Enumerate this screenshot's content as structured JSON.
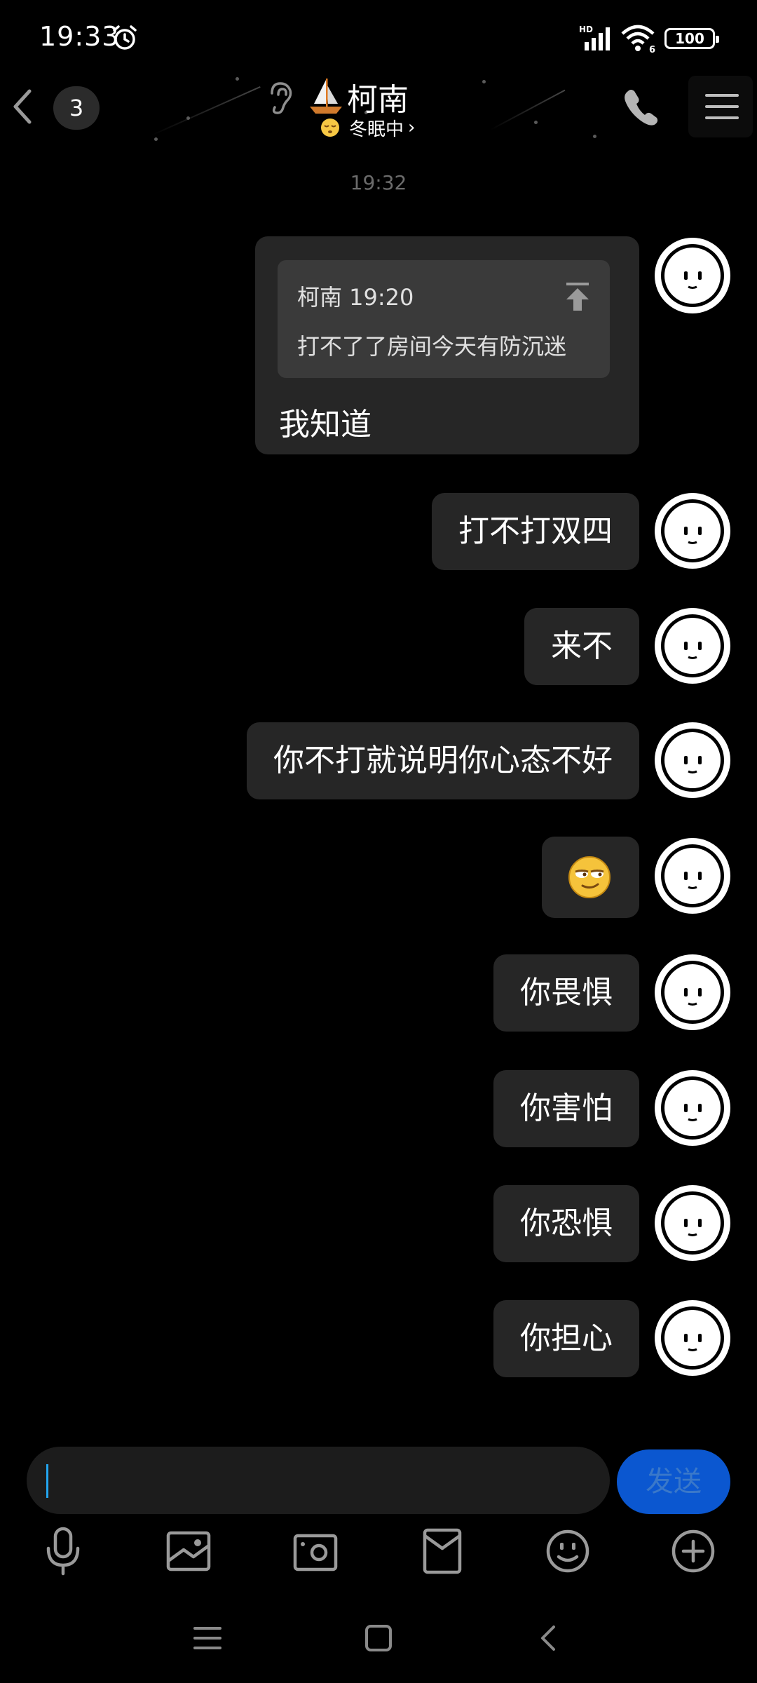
{
  "status_bar": {
    "time": "19:33",
    "battery": "100",
    "icons": [
      "alarm-icon",
      "hd-signal-icon",
      "wifi-icon",
      "battery-icon"
    ]
  },
  "header": {
    "unread_count": "3",
    "contact_name": "柯南",
    "contact_status": "冬眠中",
    "status_chevron": "›",
    "icons": [
      "back-chevron-icon",
      "ear-icon",
      "sailboat-icon",
      "sleepy-emoji-icon",
      "phone-icon",
      "menu-icon"
    ]
  },
  "chat": {
    "timestamp": "19:32",
    "quoted_message": {
      "sender_time": "柯南 19:20",
      "text": "打不了了房间今天有防沉迷",
      "reply": "我知道"
    },
    "messages": [
      "打不打双四",
      "来不",
      "你不打就说明你心态不好",
      "[smirk emoji]",
      "你畏惧",
      "你害怕",
      "你恐惧",
      "你担心"
    ]
  },
  "input": {
    "value": "",
    "send_label": "发送"
  },
  "toolbar": {
    "icons": [
      "microphone-icon",
      "image-icon",
      "camera-icon",
      "red-packet-icon",
      "emoji-icon",
      "plus-icon"
    ]
  },
  "nav_bar": {
    "icons": [
      "recents-icon",
      "home-icon",
      "back-icon"
    ]
  },
  "colors": {
    "background": "#000000",
    "bubble": "#262626",
    "send_button": "#0b57d0",
    "caret": "#23a6f0"
  }
}
